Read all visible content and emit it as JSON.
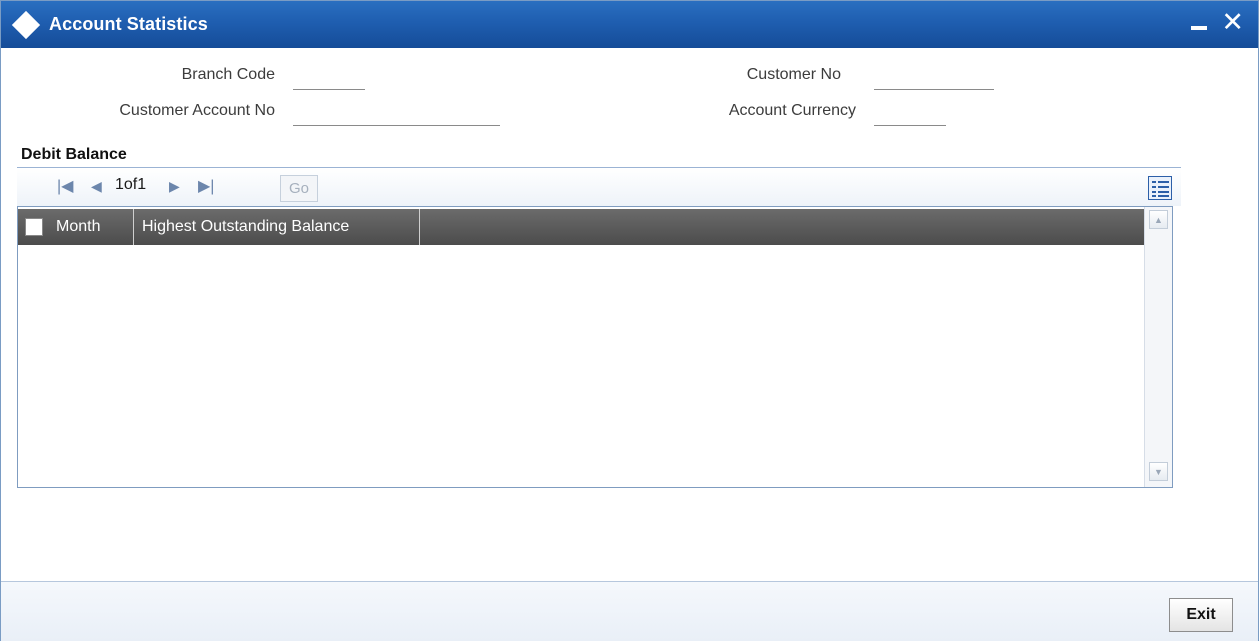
{
  "window": {
    "title": "Account Statistics",
    "minimize_icon": "minimize-icon",
    "close_icon": "close-icon",
    "close_glyph": "✕"
  },
  "fields": {
    "branch_code": {
      "label": "Branch Code",
      "value": ""
    },
    "customer_no": {
      "label": "Customer No",
      "value": ""
    },
    "customer_account_no": {
      "label": "Customer Account No",
      "value": ""
    },
    "account_currency": {
      "label": "Account Currency",
      "value": ""
    }
  },
  "debit_balance": {
    "section_title": "Debit Balance",
    "pagination": {
      "first_icon": "first-page-icon",
      "prev_icon": "previous-page-icon",
      "next_icon": "next-page-icon",
      "last_icon": "last-page-icon",
      "page_text": "1of1",
      "go_label": "Go"
    },
    "list_view_icon": "list-view-icon",
    "columns": [
      "Month",
      "Highest Outstanding Balance"
    ],
    "rows": []
  },
  "footer": {
    "exit_label": "Exit"
  },
  "colors": {
    "titlebar": "#1f5eb0",
    "grid_header": "#555555",
    "border": "#7f9cc0"
  }
}
